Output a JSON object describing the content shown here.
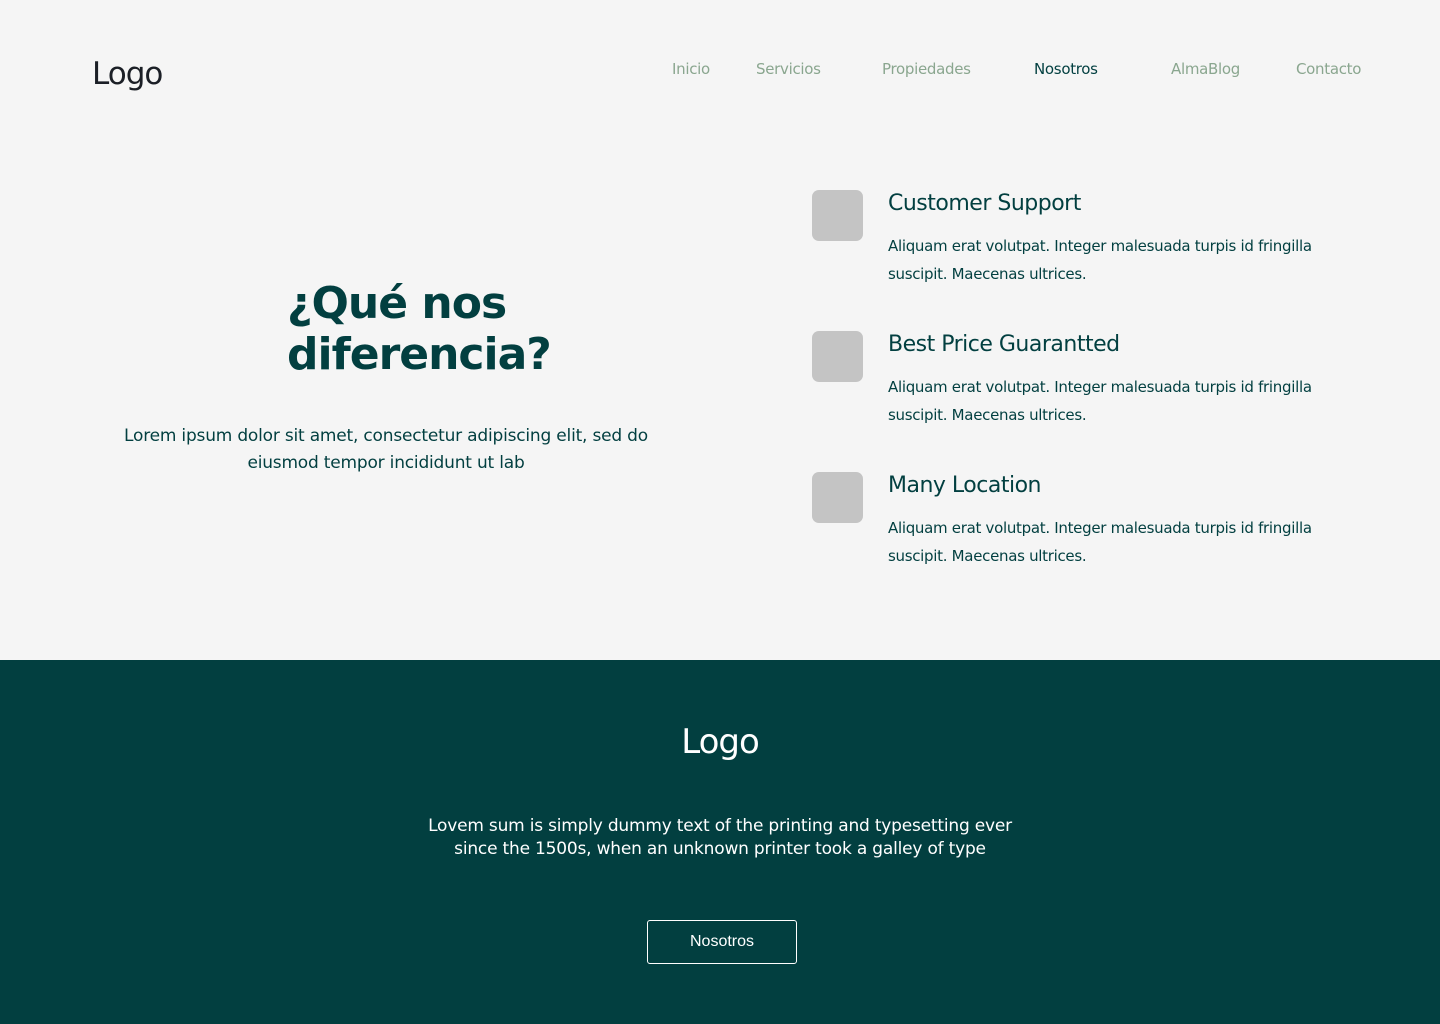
{
  "header": {
    "logo": "Logo",
    "nav": [
      {
        "label": "Inicio",
        "active": false
      },
      {
        "label": "Servicios",
        "active": false
      },
      {
        "label": "Propiedades",
        "active": false
      },
      {
        "label": "Nosotros",
        "active": true
      },
      {
        "label": "AlmaBlog",
        "active": false
      },
      {
        "label": "Contacto",
        "active": false
      }
    ]
  },
  "hero": {
    "title": "¿Qué nos diferencia?",
    "text": "Lorem ipsum dolor sit amet, consectetur adipiscing elit, sed do eiusmod tempor incididunt ut lab"
  },
  "features": [
    {
      "title": "Customer Support",
      "text": "Aliquam erat volutpat. Integer malesuada turpis id fringilla suscipit. Maecenas ultrices."
    },
    {
      "title": "Best Price Guarantted",
      "text": "Aliquam erat volutpat. Integer malesuada turpis id fringilla suscipit. Maecenas ultrices."
    },
    {
      "title": "Many Location",
      "text": "Aliquam erat volutpat. Integer malesuada turpis id fringilla suscipit. Maecenas ultrices."
    }
  ],
  "footer": {
    "logo": "Logo",
    "text": "Lovem sum is simply dummy text of the printing and typesetting ever since the 1500s, when an unknown printer took a galley of type",
    "button_label": "Nosotros"
  },
  "colors": {
    "primary": "#023f40",
    "nav_inactive": "#8aa68f",
    "background": "#f5f5f5",
    "icon_placeholder": "#c4c4c4"
  }
}
